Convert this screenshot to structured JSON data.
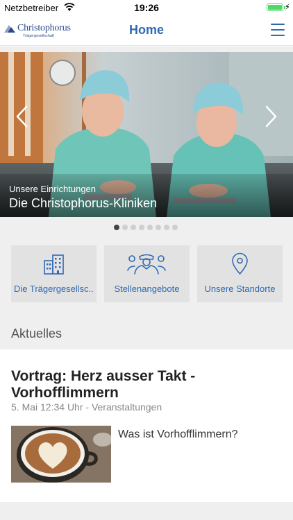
{
  "status_bar": {
    "carrier": "Netzbetreiber",
    "time": "19:26",
    "battery_level": 1.0
  },
  "nav": {
    "logo_name": "Christophorus",
    "logo_sub": "Trägergesellschaft",
    "title": "Home",
    "menu_icon": "hamburger-menu-icon",
    "accent_color": "#2f69b3"
  },
  "hero": {
    "subtitle": "Unsere Einrichtungen",
    "title": "Die Christophorus-Kliniken",
    "prev_icon": "chevron-left-icon",
    "next_icon": "chevron-right-icon",
    "slide_count": 8,
    "active_slide": 1
  },
  "tiles": [
    {
      "label": "Die Trägergesellsc...",
      "icon": "building-icon"
    },
    {
      "label": "Stellenangebote",
      "icon": "people-icon"
    },
    {
      "label": "Unsere Standorte",
      "icon": "location-pin-icon"
    }
  ],
  "news": {
    "section_title": "Aktuelles",
    "items": [
      {
        "headline": "Vortrag: Herz ausser Takt - Vorhofflimmern",
        "meta": "5. Mai 12:34 Uhr - Veranstaltungen",
        "teaser": "Was ist Vorhofflimmern?",
        "image": "coffee-latte-art-heart"
      }
    ]
  }
}
